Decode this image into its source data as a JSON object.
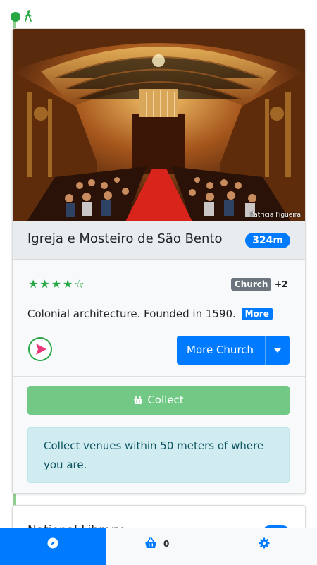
{
  "venue": {
    "name": "Igreja e Mosteiro de São Bento",
    "distance": "324m",
    "photo_credit": "Patricia Figueira",
    "rating": 4,
    "rating_max": 5,
    "stars": "★★★★☆",
    "category": "Church",
    "category_extra": "+2",
    "description": "Colonial architecture. Founded in 1590.",
    "more_label": "More",
    "more_category_label": "More Church"
  },
  "collect": {
    "button_label": "Collect",
    "info_text": "Collect venues within 50 meters of where you are."
  },
  "next_venue": {
    "name_partial": "National Library"
  },
  "tabbar": {
    "basket_count": "0"
  },
  "colors": {
    "primary": "#007bff",
    "success": "#28a745",
    "collect_button": "#72c885",
    "info_bg": "#d1ecf1",
    "info_text": "#0c5460",
    "badge_gray": "#6c757d"
  },
  "icons": {
    "timeline": "walking-icon",
    "navigate": "navigation-arrow-icon",
    "collect": "basket-collect-icon",
    "explore_tab": "compass-icon",
    "basket_tab": "shopping-basket-icon",
    "settings_tab": "gear-icon"
  }
}
